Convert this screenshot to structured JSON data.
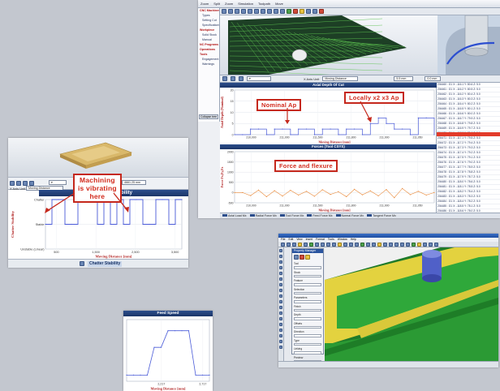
{
  "colors": {
    "brand_blue": "#1b3568",
    "callout_red": "#d22a1c",
    "plot_blue": "#4a5bd8",
    "plot_orange": "#ea8a3a",
    "cad_green": "#2f9e3b",
    "cad_yellow": "#e8d64a",
    "tool_blue": "#4a58c8"
  },
  "panel_a": {
    "menu": [
      "Zoom",
      "Split",
      "Zoom",
      "Simulation",
      "Toolpath",
      "Move"
    ],
    "tree": [
      {
        "label": "CNC Machines",
        "heading": true
      },
      {
        "label": "Types",
        "heading": false
      },
      {
        "label": "Setting Cut",
        "heading": false
      },
      {
        "label": "Specifications",
        "heading": false
      },
      {
        "label": "Workpiece",
        "heading": true
      },
      {
        "label": "Solid Stock",
        "heading": false
      },
      {
        "label": "Manual",
        "heading": false
      },
      {
        "label": "NC Programs",
        "heading": true
      },
      {
        "label": "Operations",
        "heading": true
      },
      {
        "label": "Tools",
        "heading": true
      },
      {
        "label": "Engagement",
        "heading": false
      },
      {
        "label": "Warnings",
        "heading": false
      }
    ],
    "tree_button": "Collapse tree",
    "x_axis_label_ctrl": "X Axis Unit",
    "x_axis_select": "Moving Distance",
    "value1": "5.5 mm",
    "value2": "0.0 mm",
    "chart1": {
      "title": "Axial Depth Of Cut",
      "ylabel": "Axial Depth (Nominal)",
      "xlabel": "Moving Distance [mm]",
      "callout_nominal": "Nominal Ap",
      "callout_local": "Locally x2 x3 Ap"
    },
    "chart2": {
      "title": "Forces (Tool CSYS)",
      "ylabel": "Force Fx,Fy,Fz",
      "xlabel": "Moving Distance [mm]",
      "callout": "Force and flexure"
    },
    "legend": [
      "Axial Load Mx",
      "Radial Force Mx",
      "Tool Force Mx",
      "Feed Force Mx",
      "Normal Force Mx",
      "Tangent Force Mx"
    ],
    "table_rows": [
      "204460 : G1 X: -116.1 Y: 80.6 Z: 5.0",
      "204461 : G1 X: -116.2 Y: 80.5 Z: 5.0",
      "204462 : G1 X: -116.2 Y: 80.4 Z: 5.0",
      "204463 : G1 X: -116.3 Y: 80.3 Z: 5.0",
      "204464 : G1 X: -116.4 Y: 80.2 Z: 5.0",
      "204465 : G1 X: -116.5 Y: 80.1 Z: 5.0",
      "204466 : G1 X: -116.6 Y: 80.0 Z: 5.0",
      "204467 : G1 X: -116.7 Y: 79.9 Z: 5.0",
      "204468 : G1 X: -116.8 Y: 79.8 Z: 5.0",
      "204469 : G1 X: -116.9 Y: 79.7 Z: 5.0",
      "204470 : G1 X: -117.0 Y: 79.6 Z: 5.0",
      "204471 : G1 X: -117.1 Y: 79.5 Z: 5.0",
      "204472 : G1 X: -117.2 Y: 79.4 Z: 5.0",
      "204473 : G1 X: -117.3 Y: 79.3 Z: 5.0",
      "204474 : G1 X: -117.4 Y: 79.2 Z: 5.0",
      "204475 : G1 X: -117.5 Y: 79.1 Z: 5.0",
      "204476 : G1 X: -117.6 Y: 79.0 Z: 5.0",
      "204477 : G1 X: -117.7 Y: 78.9 Z: 5.0",
      "204478 : G1 X: -117.8 Y: 78.8 Z: 5.0",
      "204479 : G1 X: -117.9 Y: 78.7 Z: 5.0",
      "204480 : G1 X: -118.0 Y: 78.6 Z: 5.0",
      "204481 : G1 X: -118.1 Y: 78.5 Z: 5.0",
      "204482 : G1 X: -118.2 Y: 78.4 Z: 5.0",
      "204483 : G1 X: -118.3 Y: 78.3 Z: 5.0",
      "204484 : G1 X: -118.4 Y: 78.2 Z: 5.0",
      "204485 : G1 X: -118.5 Y: 78.1 Z: 5.0",
      "204486 : G1 X: -118.6 Y: 78.0 Z: 5.0",
      "204487 : G1 X: -118.7 Y: 77.9 Z: 5.0",
      "204488 : G1 X: -118.8 Y: 77.8 Z: 5.0",
      "204489 : G1 X: -118.9 Y: 77.7 Z: 5.0",
      "204490 : G1 X: -119.0 Y: 77.6 Z: 5.0",
      "204491 : G1 X: -119.1 Y: 77.5 Z: 5.0"
    ]
  },
  "panel_b": {
    "x_axis_label_ctrl": "X Axis Unit",
    "x_axis_select": "Moving Distance",
    "value": "4661.25 mm",
    "callout": [
      "Machining",
      "is vibrating",
      "here"
    ],
    "footer_tab": "Chatter Stability"
  },
  "panel_c": {},
  "panel_d": {
    "menu": [
      "File",
      "Edit",
      "View",
      "Insert",
      "Format",
      "Tools",
      "Window",
      "Help"
    ],
    "dialog_title": "Property Manager",
    "dialog_items": [
      "Tool",
      "Stock",
      "Feature",
      "Selection",
      "Parameters",
      "Finish",
      "Depth",
      "Offsets",
      "Direction",
      "Type",
      "Linking",
      "Preview"
    ]
  },
  "chart_data": [
    {
      "type": "line",
      "title": "Axial Depth Of Cut",
      "xlabel": "Moving Distance [mm]",
      "ylabel": "Axial Depth (Nominal)",
      "x_ticks": [
        "210,000",
        "211,000",
        "211,500",
        "211,800",
        "211,900",
        "211,950"
      ],
      "y_ticks": [
        "0",
        "5",
        "10",
        "15",
        "20"
      ],
      "ylim": [
        0,
        20
      ],
      "series": [
        {
          "values": [
            0,
            0,
            2.5,
            2.5,
            0,
            2.5,
            2.5,
            0,
            2.5,
            2.5,
            0,
            2.5,
            2.5,
            0,
            2.5,
            2.5,
            0,
            5,
            7.5,
            5,
            2.5,
            2.5,
            0,
            7.5,
            7.5,
            0
          ]
        }
      ]
    },
    {
      "type": "line",
      "title": "Forces (Tool CSYS)",
      "xlabel": "Moving Distance [mm]",
      "ylabel": "Force Fx,Fy,Fz",
      "x_ticks": [
        "210,000",
        "211,000",
        "211,500",
        "211,800",
        "211,900",
        "211,950"
      ],
      "y_ticks": [
        "-500",
        "0",
        "500",
        "1000",
        "1500",
        "2000"
      ],
      "ylim": [
        -500,
        2000
      ],
      "series": [
        {
          "values": [
            0,
            0,
            -150,
            120,
            -200,
            90,
            -170,
            110,
            -120,
            60,
            -180,
            140,
            -90,
            40,
            -200,
            160,
            -110,
            80,
            -160,
            150,
            -250,
            200,
            -100,
            60,
            -120,
            0
          ]
        }
      ]
    },
    {
      "type": "line",
      "title": "Chatter Stability",
      "xlabel": "Moving Distance [mm]",
      "ylabel": "Chatter Stability",
      "x_ticks": [
        "500",
        "1,500",
        "2,500",
        "3,500"
      ],
      "y_ticks": [
        "Unstable (Linear)",
        "Stable",
        "Chatter"
      ],
      "ylim": [
        0,
        2
      ],
      "series": [
        {
          "values": [
            1,
            2,
            2,
            1,
            1,
            2,
            2,
            2,
            1,
            2,
            1,
            2,
            1,
            2,
            2,
            1,
            1,
            2,
            2,
            1,
            2,
            2
          ]
        }
      ]
    },
    {
      "type": "line",
      "title": "Feed Speed",
      "xlabel": "Moving Distance [mm]",
      "ylabel": "",
      "x_ticks": [
        "2,217",
        "2,717"
      ],
      "y_ticks": [],
      "ylim": [
        0,
        1
      ],
      "series": [
        {
          "values": [
            0.1,
            0.1,
            0.1,
            0.1,
            0.55,
            0.55,
            0.82,
            0.82,
            0.82,
            0.82,
            0.1,
            0.1,
            0.1
          ]
        }
      ]
    }
  ]
}
